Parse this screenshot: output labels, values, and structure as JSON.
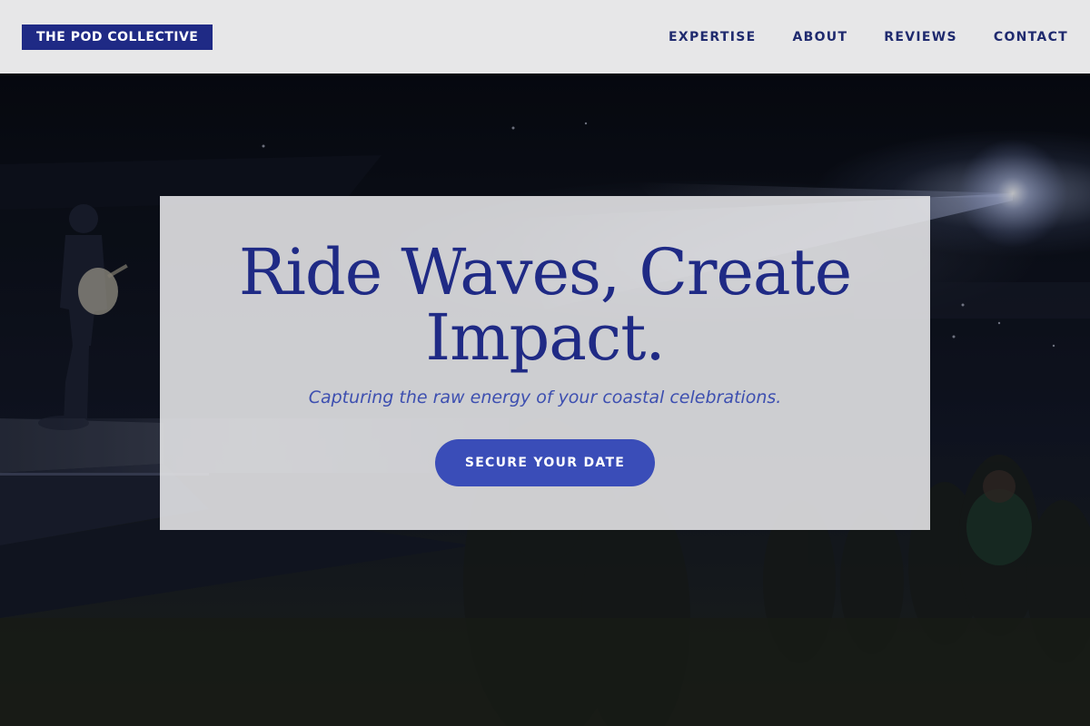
{
  "header": {
    "logo": "THE POD COLLECTIVE",
    "nav": [
      {
        "label": "EXPERTISE"
      },
      {
        "label": "ABOUT"
      },
      {
        "label": "REVIEWS"
      },
      {
        "label": "CONTACT"
      }
    ]
  },
  "hero": {
    "title": "Ride Waves, Create Impact.",
    "subtitle": "Capturing the raw energy of your coastal celebrations.",
    "cta_label": "SECURE YOUR DATE",
    "background_image": "concert-stage-photo"
  },
  "colors": {
    "header_bg": "#e7e7e8",
    "brand": "#1f2a85",
    "accent": "#3a4db8",
    "hero_card_bg": "#e8e8ea"
  }
}
